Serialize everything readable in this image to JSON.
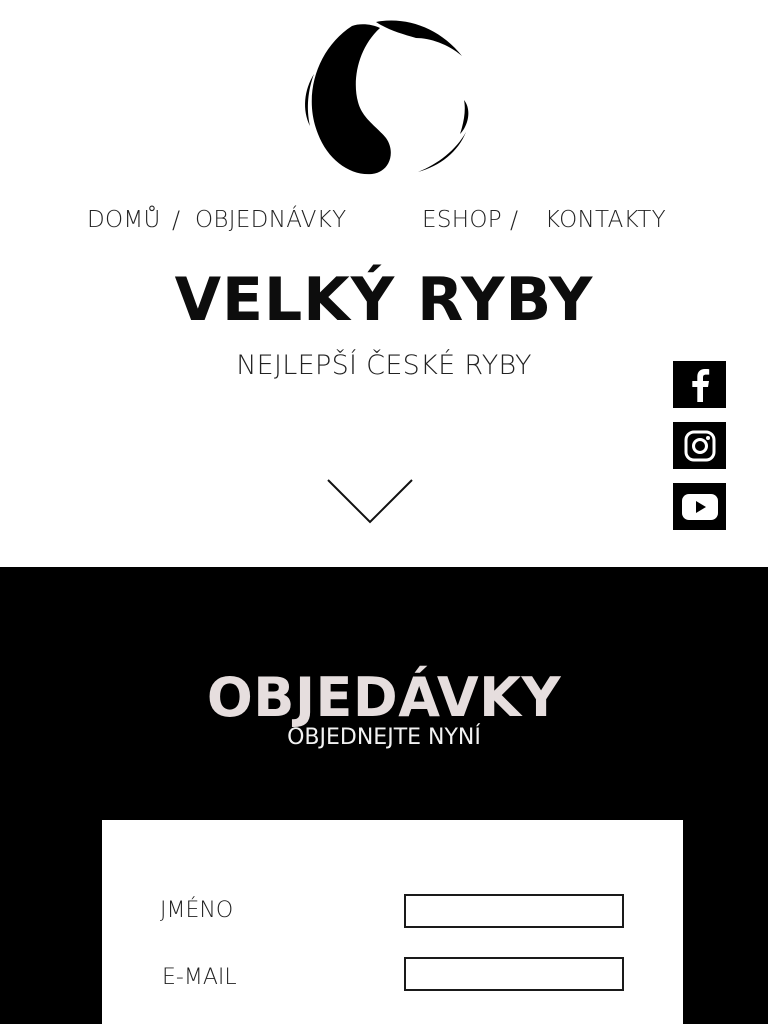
{
  "site": {
    "logo_icon": "fish-circle-logo-icon"
  },
  "nav": {
    "items": [
      {
        "label": "DOMŮ"
      },
      {
        "label": "OBJEDNÁVKY"
      },
      {
        "label": "ESHOP"
      },
      {
        "label": "KONTAKTY"
      }
    ],
    "separator": "/"
  },
  "hero": {
    "title": "VELKÝ RYBY",
    "subtitle": "NEJLEPŠÍ ČESKÉ RYBY",
    "scroll_icon": "chevron-down-icon"
  },
  "social": [
    {
      "name": "facebook",
      "icon": "facebook-icon"
    },
    {
      "name": "instagram",
      "icon": "instagram-icon"
    },
    {
      "name": "youtube",
      "icon": "youtube-icon"
    }
  ],
  "orders": {
    "title": "OBJEDÁVKY",
    "subtitle": "OBJEDNEJTE NYNÍ",
    "form": {
      "name_label": "JMÉNO",
      "name_value": "",
      "email_label": "E-MAIL",
      "email_value": ""
    }
  },
  "colors": {
    "background": "#ffffff",
    "dark_section": "#000000",
    "heading_on_dark": "#e6dede",
    "text": "#111111"
  }
}
